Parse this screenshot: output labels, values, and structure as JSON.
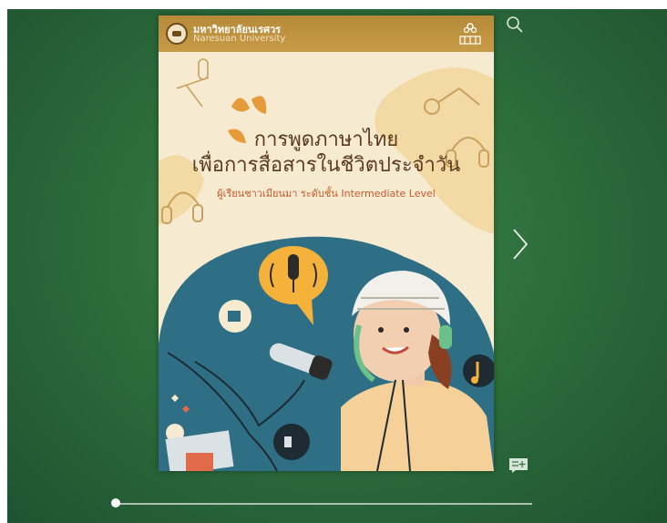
{
  "book": {
    "university_th": "มหาวิทยาลัยนเรศวร",
    "university_en": "Naresuan University",
    "title_line1": "การพูดภาษาไทย",
    "title_line2": "เพื่อการสื่อสารในชีวิตประจำวัน",
    "subtitle": "ผู้เรียนชาวเมียนมา ระดับชั้น Intermediate Level"
  },
  "controls": {
    "search_icon": "search-icon",
    "next_icon": "chevron-right-icon",
    "notes_icon": "add-note-icon",
    "page_progress": 0.0
  },
  "colors": {
    "background": "#2e6e3c",
    "header": "#c79a46",
    "cover": "#f6ead1",
    "title": "#5b3a1f",
    "subtitle": "#c55a2c",
    "blob": "#2f6f86"
  }
}
